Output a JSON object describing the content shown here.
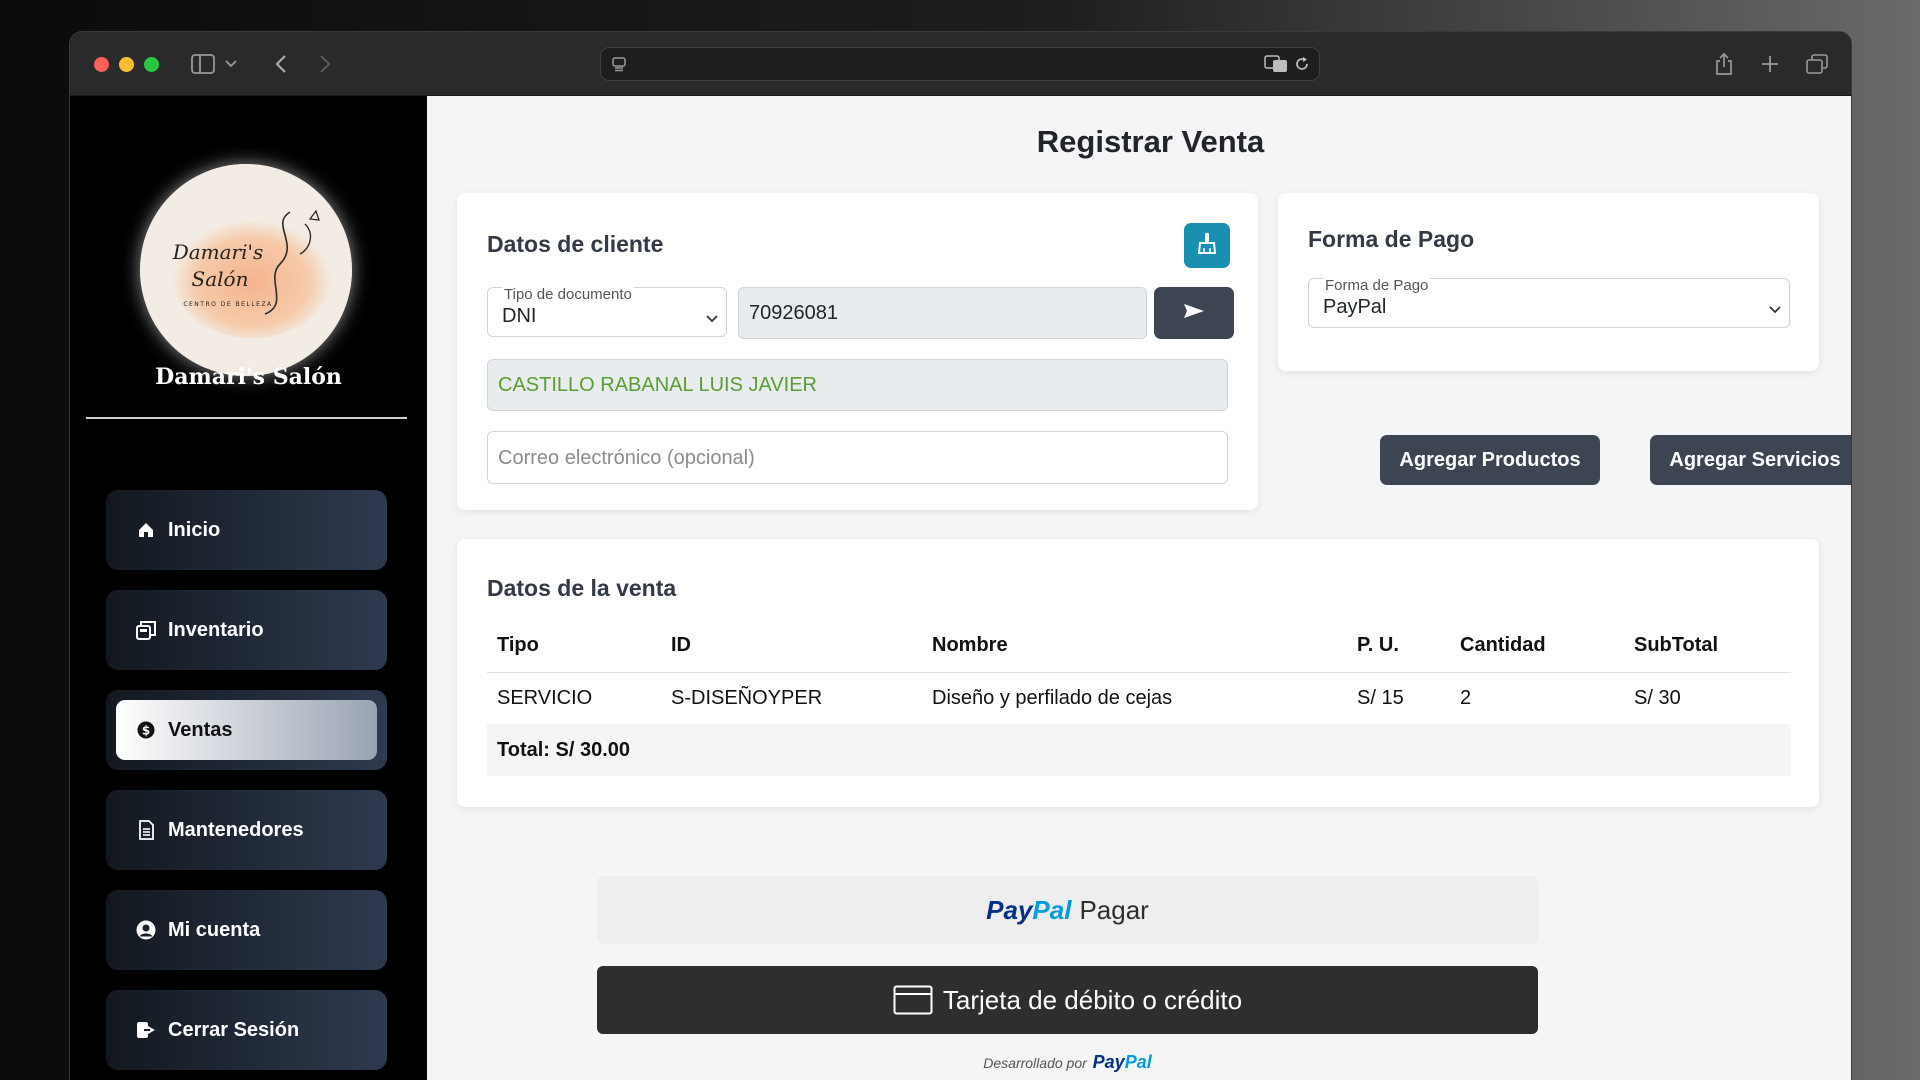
{
  "sidebar": {
    "logo_text": "Damari's Salón",
    "logo_subtext": "CENTRO DE BELLEZA",
    "brand": "Damari's Salón",
    "items": [
      {
        "label": "Inicio",
        "icon": "home-icon"
      },
      {
        "label": "Inventario",
        "icon": "inventory-icon"
      },
      {
        "label": "Ventas",
        "icon": "dollar-icon",
        "active": true
      },
      {
        "label": "Mantenedores",
        "icon": "document-icon"
      },
      {
        "label": "Mi cuenta",
        "icon": "user-circle-icon"
      },
      {
        "label": "Cerrar Sesión",
        "icon": "logout-icon"
      }
    ]
  },
  "page": {
    "title": "Registrar Venta"
  },
  "client": {
    "title": "Datos de cliente",
    "doc_type_label": "Tipo de documento",
    "doc_type_value": "DNI",
    "doc_number": "70926081",
    "name": "CASTILLO RABANAL LUIS JAVIER",
    "email_placeholder": "Correo electrónico (opcional)"
  },
  "payment": {
    "title": "Forma de Pago",
    "select_label": "Forma de Pago",
    "select_value": "PayPal",
    "add_products": "Agregar Productos",
    "add_services": "Agregar Servicios"
  },
  "sale": {
    "title": "Datos de la venta",
    "headers": [
      "Tipo",
      "ID",
      "Nombre",
      "P. U.",
      "Cantidad",
      "SubTotal"
    ],
    "rows": [
      [
        "SERVICIO",
        "S-DISEÑOYPER",
        "Diseño y perfilado de cejas",
        "S/ 15",
        "2",
        "S/ 30"
      ]
    ],
    "total": "Total: S/ 30.00"
  },
  "paypal": {
    "logo_pay": "Pay",
    "logo_pal": "Pal",
    "pay_label": "Pagar",
    "card_label": "Tarjeta de débito o crédito",
    "powered_by": "Desarrollado por"
  },
  "colors": {
    "accent_teal": "#1b8fb1",
    "dark_button": "#3d4553",
    "client_name_green": "#5a9e2e"
  }
}
